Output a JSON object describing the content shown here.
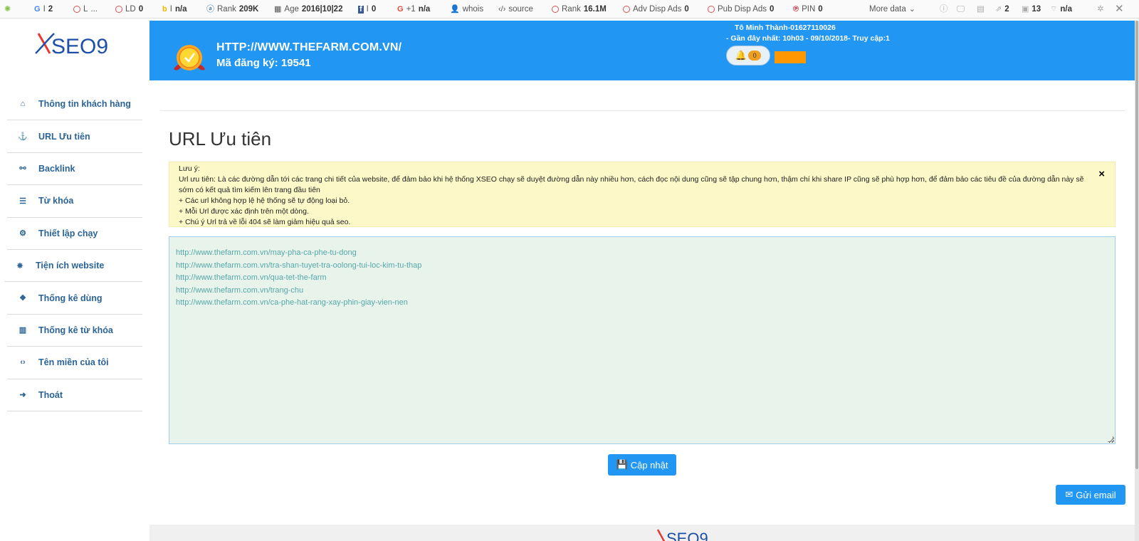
{
  "toolbar": {
    "items": [
      {
        "label": "G",
        "sep": "I",
        "value": "2"
      },
      {
        "label": "L",
        "sep": "",
        "value": "..."
      },
      {
        "label": "LD",
        "value": "0"
      },
      {
        "label": "I",
        "value": "n/a"
      },
      {
        "label": "Rank",
        "value": "209K"
      },
      {
        "label": "Age",
        "value": "2016|10|22"
      },
      {
        "label": "I",
        "value": "0"
      },
      {
        "label": "+1",
        "value": "n/a"
      },
      {
        "label": "whois",
        "value": ""
      },
      {
        "label": "source",
        "value": ""
      },
      {
        "label": "Rank",
        "value": "16.1M"
      },
      {
        "label": "Adv Disp Ads",
        "value": "0"
      },
      {
        "label": "Pub Disp Ads",
        "value": "0"
      },
      {
        "label": "PIN",
        "value": "0"
      },
      {
        "label": "More data",
        "value": ""
      },
      {
        "label": "",
        "value": "2"
      },
      {
        "label": "",
        "value": "13"
      },
      {
        "label": "",
        "value": "n/a"
      }
    ]
  },
  "sidebar": {
    "logo_text": "XSEO9",
    "items": [
      {
        "label": "Thông tin khách hàng",
        "icon": "home-icon"
      },
      {
        "label": "URL Ưu tiên",
        "icon": "anchor-icon"
      },
      {
        "label": "Backlink",
        "icon": "link-icon"
      },
      {
        "label": "Từ khóa",
        "icon": "list-icon"
      },
      {
        "label": "Thiết lập chạy",
        "icon": "gear-icon"
      },
      {
        "label": "Tiện ích website",
        "icon": "bug-icon"
      },
      {
        "label": "Thống kê dùng",
        "icon": "cubes-icon"
      },
      {
        "label": "Thống kê từ khóa",
        "icon": "bar-chart-icon"
      },
      {
        "label": "Tên miền của tôi",
        "icon": "code-icon"
      },
      {
        "label": "Thoát",
        "icon": "sign-out-icon"
      }
    ]
  },
  "header": {
    "site_url": "HTTP://WWW.THEFARM.COM.VN/",
    "reg_number": "Mã đăng ký: 19541",
    "user": "Tô Minh Thành-01627110026",
    "last_access": "- Gần đây nhất: 10h03 - 09/10/2018- Truy cập:1",
    "notif_count": "0",
    "accent": "#2196f3"
  },
  "main": {
    "title": "URL Ưu tiên",
    "alert": {
      "heading": "Lưu ý:",
      "line1": "Url ưu tiên: Là các đường dẫn tới các trang chi tiết của website, để đảm bảo khi hệ thống XSEO chạy sẽ duyệt đường dẫn này nhiều hơn, cách đọc nội dung cũng sẽ tập chung hơn, thậm chí khi share IP cũng sẽ phù hợp hơn, để đảm bảo các tiêu đề của đường dẫn này sẽ sớm có kết quả tìm kiếm lên trang đầu tiên",
      "line2": "+ Các url không hợp lệ hệ thống sẽ tự động loại bỏ.",
      "line3": "+ Mỗi Url được xác định trên một dòng.",
      "line4": "+ Chú ý Url trả về lỗi 404 sẽ làm giảm hiệu quả seo.",
      "close": "×"
    },
    "urls": [
      "http://www.thefarm.com.vn/may-pha-ca-phe-tu-dong",
      "http://www.thefarm.com.vn/tra-shan-tuyet-tra-oolong-tui-loc-kim-tu-thap",
      "http://www.thefarm.com.vn/qua-tet-the-farm",
      "http://www.thefarm.com.vn/trang-chu",
      "http://www.thefarm.com.vn/ca-phe-hat-rang-xay-phin-giay-vien-nen"
    ],
    "update_label": "Cập nhật",
    "email_label": "Gửi email"
  }
}
